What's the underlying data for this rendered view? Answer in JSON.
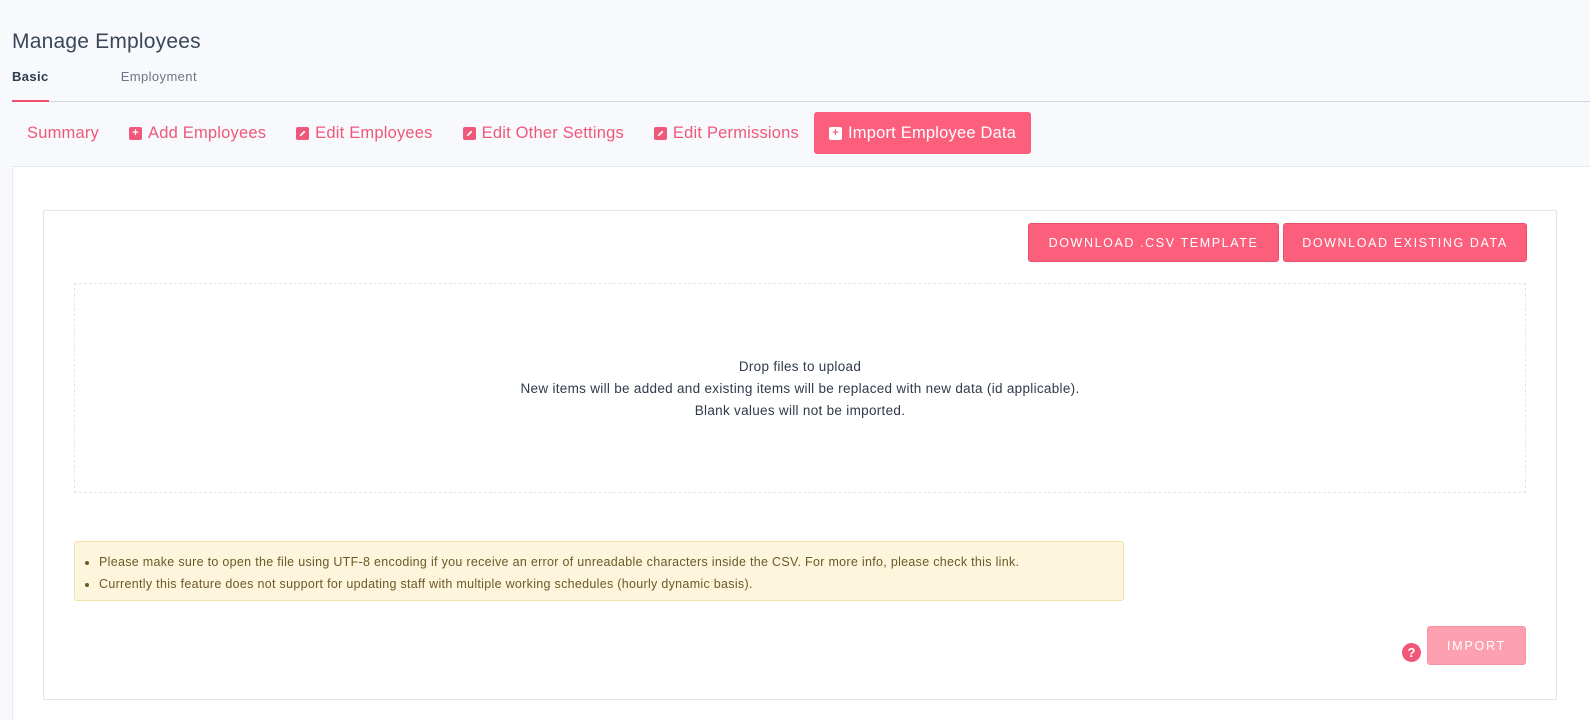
{
  "page": {
    "title": "Manage Employees"
  },
  "top_tabs": [
    {
      "label": "Basic",
      "active": true
    },
    {
      "label": "Employment",
      "active": false
    }
  ],
  "sub_tabs": [
    {
      "label": "Summary",
      "icon": "none",
      "active": false
    },
    {
      "label": "Add Employees",
      "icon": "plus-square-icon",
      "active": false
    },
    {
      "label": "Edit Employees",
      "icon": "pencil-square-icon",
      "active": false
    },
    {
      "label": "Edit Other Settings",
      "icon": "pencil-square-icon",
      "active": false
    },
    {
      "label": "Edit Permissions",
      "icon": "pencil-square-icon",
      "active": false
    },
    {
      "label": "Import Employee Data",
      "icon": "plus-square-icon",
      "active": true
    }
  ],
  "actions": {
    "download_template": "DOWNLOAD .CSV TEMPLATE",
    "download_existing": "DOWNLOAD EXISTING DATA",
    "import": "IMPORT"
  },
  "dropzone": {
    "line1": "Drop files to upload",
    "line2": "New items will be added and existing items will be replaced with new data (id applicable).",
    "line3": "Blank values will not be imported."
  },
  "notice": {
    "items": [
      "Please make sure to open the file using UTF-8 encoding if you receive an error of unreadable characters inside the CSV. For more info, please check this link.",
      "Currently this feature does not support for updating staff with multiple working schedules (hourly dynamic basis)."
    ]
  },
  "colors": {
    "accent": "#fb5f7c",
    "accent_disabled": "#fda1b1",
    "notice_bg": "#fdf6dd"
  }
}
